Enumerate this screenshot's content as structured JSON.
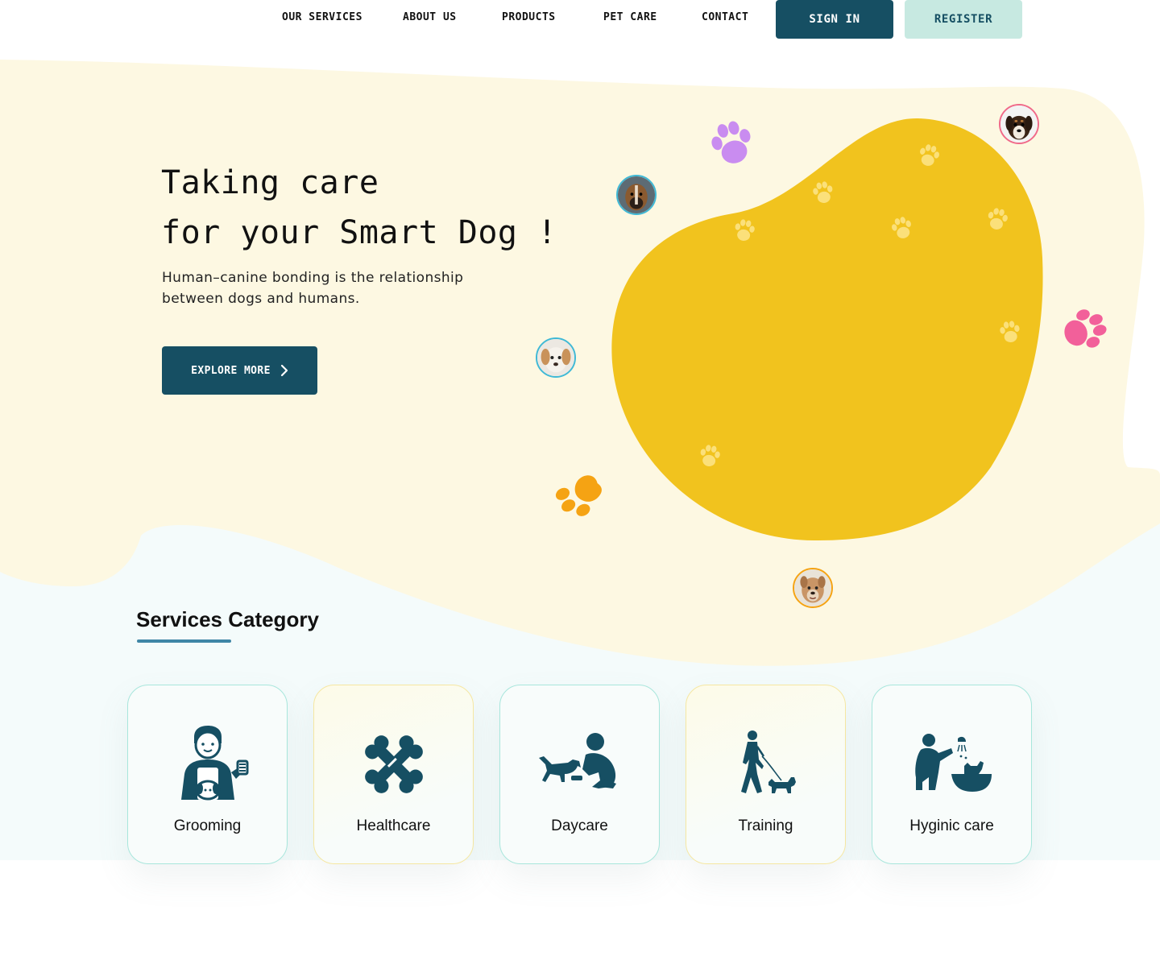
{
  "nav": {
    "links": [
      "Our Services",
      "About Us",
      "Products",
      "Pet Care",
      "Contact"
    ],
    "sign_in": "Sign In",
    "register": "Register"
  },
  "hero": {
    "title_line1": "Taking care",
    "title_line2": "for your Smart Dog !",
    "subtitle": "Human–canine bonding is the relationship between dogs and humans.",
    "cta": "Explore More"
  },
  "services": {
    "title": "Services Category",
    "items": [
      {
        "label": "Grooming",
        "icon": "groomer-icon"
      },
      {
        "label": "Healthcare",
        "icon": "bone-icon"
      },
      {
        "label": "Daycare",
        "icon": "person-with-dog-icon"
      },
      {
        "label": "Training",
        "icon": "dog-walking-icon"
      },
      {
        "label": "Hyginic care",
        "icon": "dog-bathing-icon"
      }
    ]
  },
  "colors": {
    "primary": "#164f63",
    "accent_light": "#c7e9e1",
    "blob_yellow": "#f1c31e",
    "cream": "#fdf8e2",
    "paw_purple": "#c98cf0",
    "paw_pink": "#f2609a",
    "paw_orange": "#f5a313"
  }
}
